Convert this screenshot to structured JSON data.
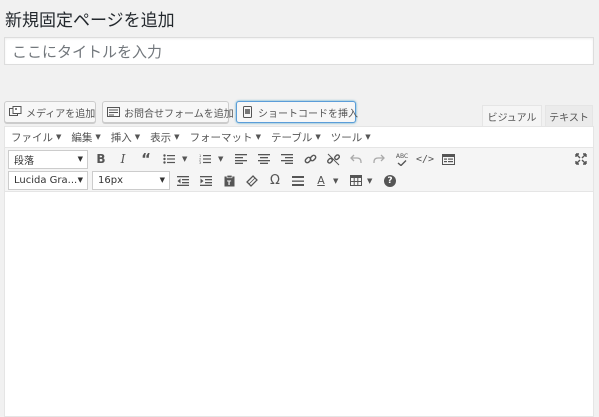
{
  "page": {
    "title": "新規固定ページを追加"
  },
  "title_field": {
    "placeholder": "ここにタイトルを入力"
  },
  "media_buttons": {
    "add_media": "メディアを追加",
    "add_form": "お問合せフォームを追加",
    "insert_shortcode": "ショートコードを挿入"
  },
  "editor_tabs": {
    "visual": "ビジュアル",
    "text": "テキスト"
  },
  "menubar": [
    {
      "label": "ファイル"
    },
    {
      "label": "編集"
    },
    {
      "label": "挿入"
    },
    {
      "label": "表示"
    },
    {
      "label": "フォーマット"
    },
    {
      "label": "テーブル"
    },
    {
      "label": "ツール"
    }
  ],
  "toolbar1": {
    "format_select": "段落",
    "icons": [
      "bold-icon",
      "italic-icon",
      "blockquote-icon",
      "bullet-list-icon",
      "numbered-list-icon",
      "align-left-icon",
      "align-center-icon",
      "align-right-icon",
      "link-icon",
      "unlink-icon",
      "undo-icon",
      "redo-icon",
      "spellcheck-icon",
      "code-icon",
      "toolbar-toggle-icon",
      "fullscreen-icon"
    ],
    "spellcheck_label": "ABC"
  },
  "toolbar2": {
    "font_family_select": "Lucida Gra...",
    "font_size_select": "16px",
    "icons": [
      "outdent-icon",
      "indent-icon",
      "paste-text-icon",
      "clear-formatting-icon",
      "special-character-icon",
      "horizontal-rule-icon",
      "text-color-icon",
      "table-icon",
      "help-icon"
    ],
    "special_char_glyph": "Ω",
    "text_color_glyph": "A",
    "help_glyph": "?"
  }
}
